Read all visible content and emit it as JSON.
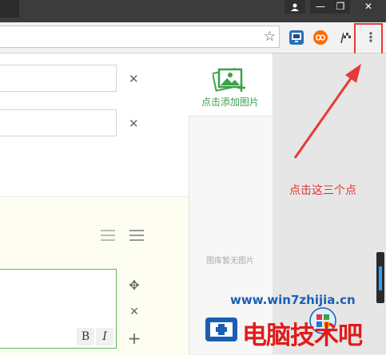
{
  "window": {
    "minimize": "—",
    "restore": "❐",
    "close": "✕",
    "user": "👤"
  },
  "toolbar": {
    "star": "☆",
    "menu_dots": "⋮"
  },
  "form": {
    "close_glyph": "✕"
  },
  "editor": {
    "bold": "B",
    "italic": "I",
    "move": "✥",
    "remove": "✕",
    "add": "+"
  },
  "image_panel": {
    "add_label": "点击添加图片",
    "empty_label": "图库暂无图片"
  },
  "annotation": {
    "text": "点击这三个点"
  },
  "watermark": {
    "url": "www.win7zhijia.cn",
    "brand": "电脑技术吧"
  },
  "colors": {
    "annotation": "#e53a3a",
    "accent_green": "#3aa24a",
    "editor_border": "#5cb85c"
  }
}
